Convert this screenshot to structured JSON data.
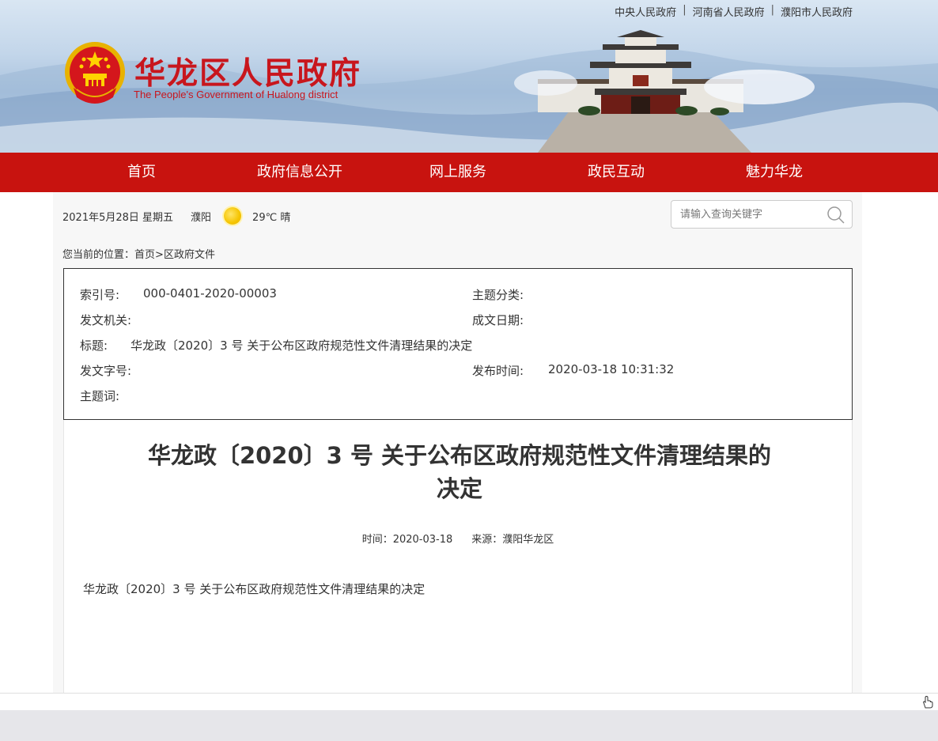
{
  "top_links": [
    "中央人民政府",
    "河南省人民政府",
    "濮阳市人民政府"
  ],
  "top_links_separator": "|",
  "site": {
    "title": "华龙区人民政府",
    "subtitle": "The People's Government of Hualong district",
    "brand_color": "#c8161d"
  },
  "nav": {
    "background": "#c8130f",
    "items": [
      "首页",
      "政府信息公开",
      "网上服务",
      "政民互动",
      "魅力华龙"
    ]
  },
  "info_bar": {
    "date": "2021年5月28日 星期五",
    "city": "濮阳",
    "weather_icon": "sun-icon",
    "weather": "29℃ 晴"
  },
  "search": {
    "placeholder": "请输入查询关键字",
    "icon": "search-icon"
  },
  "breadcrumb": {
    "prefix": "您当前的位置：",
    "home": "首页",
    "separator": ">",
    "current": "区政府文件"
  },
  "meta": {
    "index_no_label": "索引号:",
    "index_no": "000-0401-2020-00003",
    "category_label": "主题分类:",
    "category": "",
    "issuer_label": "发文机关:",
    "issuer": "",
    "created_label": "成文日期:",
    "created": "",
    "title_label": "标题:",
    "title": "华龙政〔2020〕3 号 关于公布区政府规范性文件清理结果的决定",
    "doc_no_label": "发文字号:",
    "doc_no": "",
    "published_label": "发布时间:",
    "published": "2020-03-18 10:31:32",
    "keywords_label": "主题词:",
    "keywords": ""
  },
  "article": {
    "title": "华龙政〔2020〕3 号 关于公布区政府规范性文件清理结果的决定",
    "time": "时间：2020-03-18",
    "source": "来源：濮阳华龙区",
    "body": "华龙政〔2020〕3 号 关于公布区政府规范性文件清理结果的决定"
  }
}
